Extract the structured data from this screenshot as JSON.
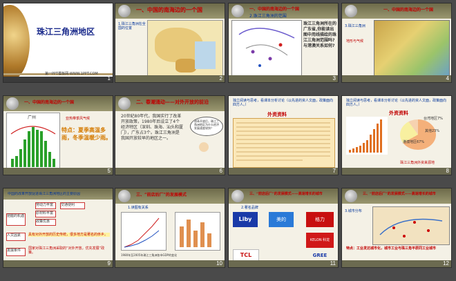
{
  "slides": [
    {
      "num": "1",
      "title": "珠江三角洲地区",
      "footer": "第一PPT模板网-WWW.1PPT.COM"
    },
    {
      "num": "2",
      "title": "一、中国的南海边的一个国",
      "label": "1.珠江三角洲在全国的位置"
    },
    {
      "num": "3",
      "title": "一、中国的南海边的一个国",
      "label": "2.珠江三角洲的范围",
      "side": "珠江三角洲所在的广东省,你能读出图中用线描绘的珠江三角洲范围吗?与港澳关系如何?"
    },
    {
      "num": "4",
      "title": "一、中国的南海边的一个国",
      "label": "3.珠江三角洲",
      "side2": "地形与气候"
    },
    {
      "num": "5",
      "title": "一、中国的南海边的一个国",
      "city": "广州",
      "legend": "亚热带季风气候",
      "feature": "特点：夏季高温多雨，冬季温暖少雨。"
    },
    {
      "num": "6",
      "title": "二、春潮涌动——对外开放的前沿",
      "body": "20世纪80年代，我国实行了改革开放政策，1980年后设立了4个经济特区（深圳、珠海、汕头和厦门），广东占3个。珠江三角洲是我国开放较早的地区之一。",
      "bubble": "改革开放后，珠江三角洲地区为什么经济发展速度较快？"
    },
    {
      "num": "7",
      "top": "独立阅读与思考，看课本分析讨论（以先进的资人文面，政策面向四方人。）",
      "heading": "外资资料"
    },
    {
      "num": "8",
      "top": "独立阅读与思考，看课本分析讨论（以先进的资人文面，政策面向四方人。）",
      "heading": "外资资料",
      "pie": [
        "台湾地区7%",
        "其他23%",
        "港澳地区67%"
      ],
      "caption": "珠江三角洲外资来源地"
    },
    {
      "num": "9",
      "title": "中国的改革开放促进珠江三角洲地区的主要原因",
      "items": [
        "劳动力丰富",
        "原材料丰富",
        "政策优惠",
        "交通便利"
      ],
      "box1": "把握的机遇",
      "box2": "人文因素",
      "note": "具有对外开放的历史传统，很多地方是著名的侨乡。",
      "box3": "发展条件",
      "note2": "国家对珠江三角洲采取的“对外开放，优先发展”政策。"
    },
    {
      "num": "10",
      "title": "三、“前店后厂”的发展模式",
      "label": "1.读图有关系",
      "caption": "1980年至2005年珠江三角洲各市GDP的变化"
    },
    {
      "num": "11",
      "title": "三、“前店后厂”的发展模式——高速增长的城市",
      "label": "2.著名品牌",
      "brands": [
        "Liby",
        "美的",
        "格力",
        "TCL",
        "GREE",
        "KELON 科龙"
      ]
    },
    {
      "num": "12",
      "title": "三、“前店后厂”的发展模式——高速增长的城市",
      "label": "3.城市分布",
      "note": "特点：工业发达城市化，城市工业与珠三角平原同工业城市"
    }
  ]
}
